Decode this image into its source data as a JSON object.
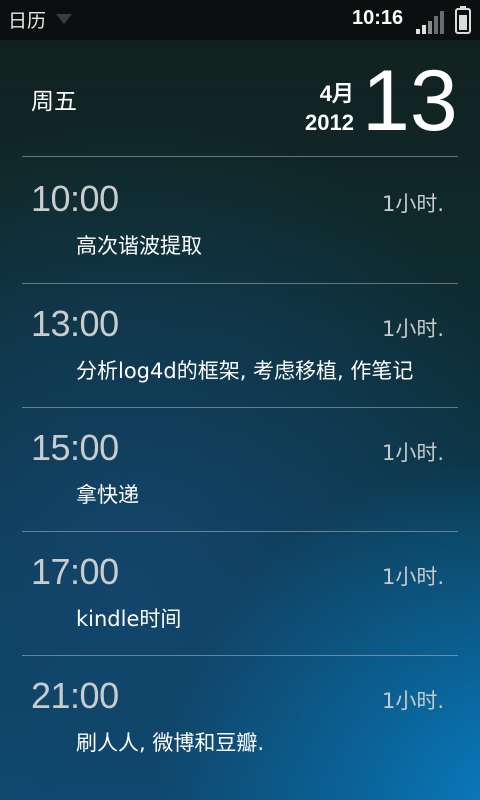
{
  "status_bar": {
    "app_title": "日历",
    "time": "10:16",
    "icons": [
      "dropdown-arrow-icon",
      "signal-icon",
      "battery-icon"
    ]
  },
  "header": {
    "weekday": "周五",
    "month": "4月",
    "year": "2012",
    "day": "13"
  },
  "events": [
    {
      "time": "10:00",
      "duration": "1小时.",
      "title": "高次谐波提取"
    },
    {
      "time": "13:00",
      "duration": "1小时.",
      "title": "分析log4d的框架, 考虑移植, 作笔记"
    },
    {
      "time": "15:00",
      "duration": "1小时.",
      "title": "拿快递"
    },
    {
      "time": "17:00",
      "duration": "1小时.",
      "title": "kindle时间"
    },
    {
      "time": "21:00",
      "duration": "1小时.",
      "title": "刷人人, 微博和豆瓣."
    }
  ],
  "colors": {
    "status_bar_bg": "#0b0f10",
    "time_text": "#c9cccc",
    "title_text": "#ffffff",
    "divider": "#c8d2d7"
  }
}
